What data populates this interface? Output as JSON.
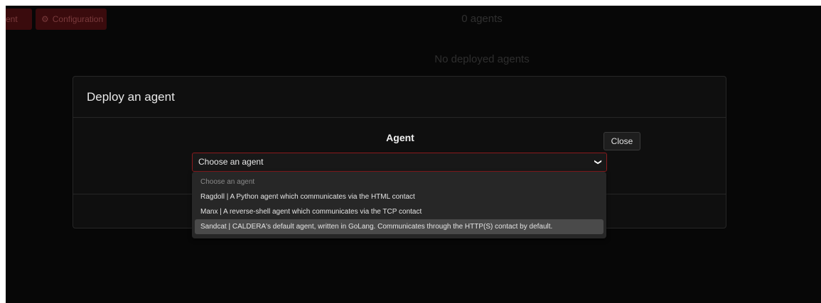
{
  "background": {
    "agents_button_label": "ent",
    "config_button_label": "Configuration",
    "agent_count": "0 agents",
    "empty_message": "No deployed agents"
  },
  "modal": {
    "title": "Deploy an agent",
    "field_label": "Agent",
    "select": {
      "selected": "Choose an agent",
      "options": [
        "Choose an agent",
        "Ragdoll | A Python agent which communicates via the HTML contact",
        "Manx | A reverse-shell agent which communicates via the TCP contact",
        "Sandcat | CALDERA's default agent, written in GoLang. Communicates through the HTTP(S) contact by default."
      ],
      "highlighted_index": 3
    },
    "close_label": "Close"
  },
  "colors": {
    "accent": "#8b1a1d",
    "background": "#070707",
    "modal": "#0f0f0f",
    "dropdown": "#272727"
  }
}
